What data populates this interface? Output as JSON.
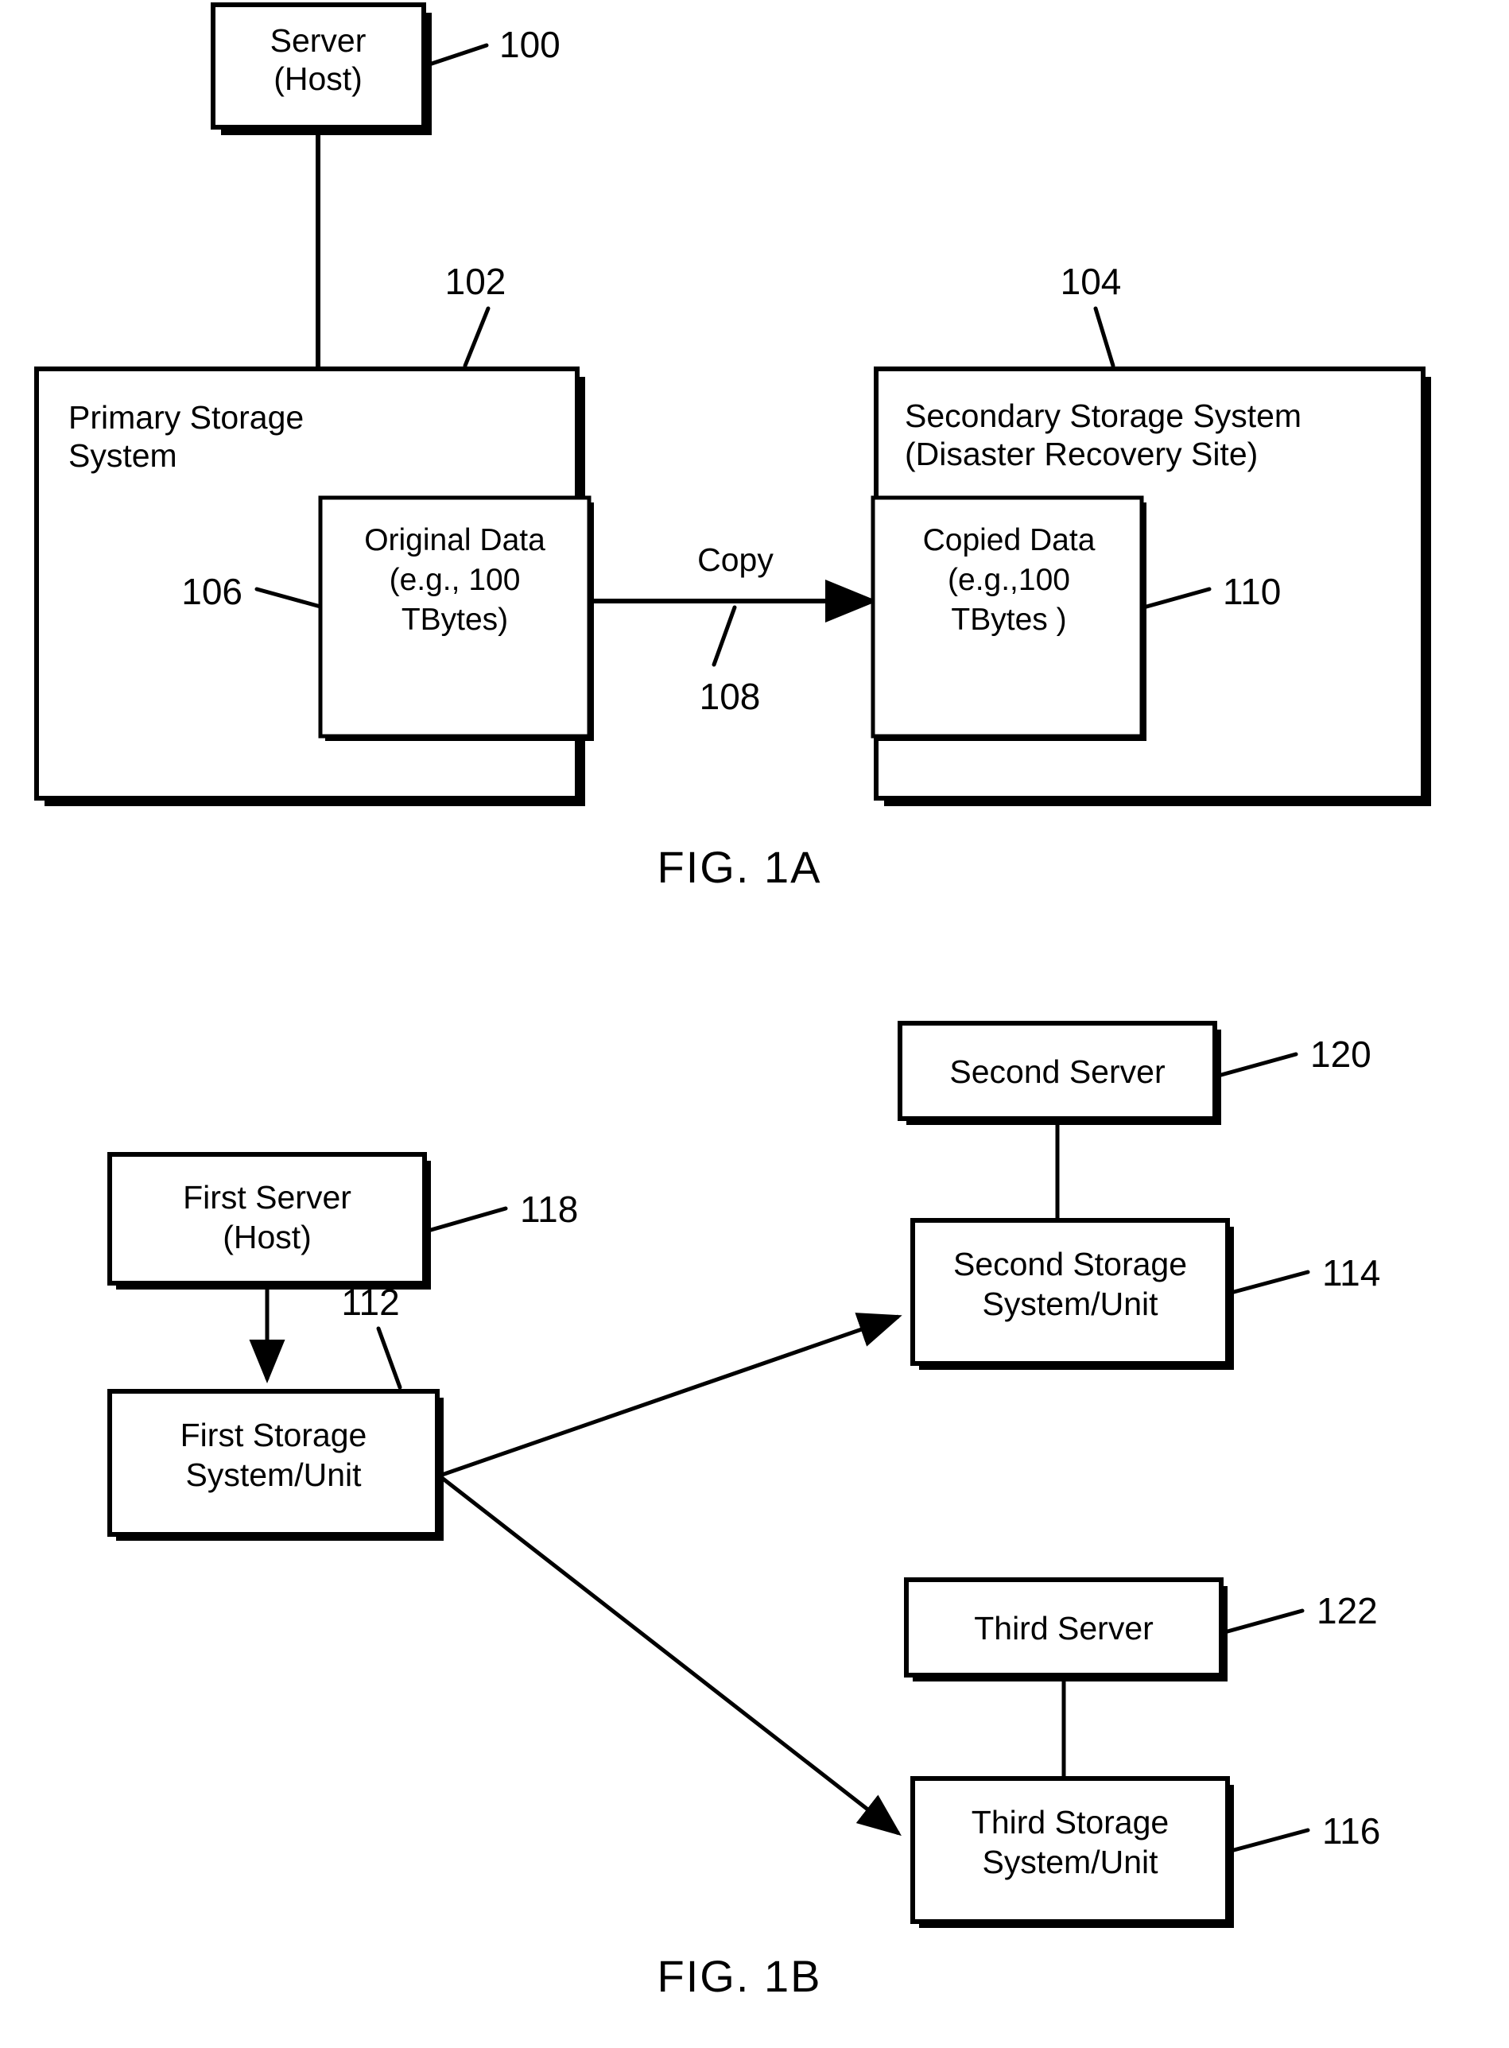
{
  "sheet": {
    "figures": [
      {
        "id": "fig-1a",
        "caption": "FIG. 1A",
        "nodes": [
          {
            "id": "server-host",
            "lines": [
              "Server",
              "(Host)"
            ],
            "ref": "100"
          },
          {
            "id": "primary-storage-system",
            "lines": [
              "Primary Storage",
              "System"
            ],
            "ref": "102"
          },
          {
            "id": "original-data",
            "lines": [
              "Original Data",
              "(e.g., 100",
              "TBytes)"
            ],
            "ref": "106"
          },
          {
            "id": "secondary-storage-system",
            "lines": [
              "Secondary Storage System",
              "(Disaster Recovery Site)"
            ],
            "ref": "104"
          },
          {
            "id": "copied-data",
            "lines": [
              "Copied Data",
              "(e.g.,100",
              "TBytes )"
            ],
            "ref": "110"
          }
        ],
        "edges": [
          {
            "id": "copy-arrow",
            "label": "Copy",
            "ref": "108",
            "from": "original-data",
            "to": "copied-data"
          },
          {
            "id": "host-to-primary",
            "label": "",
            "ref": "",
            "from": "server-host",
            "to": "primary-storage-system"
          }
        ]
      },
      {
        "id": "fig-1b",
        "caption": "FIG. 1B",
        "nodes": [
          {
            "id": "first-server",
            "lines": [
              "First Server",
              "(Host)"
            ],
            "ref": "118"
          },
          {
            "id": "first-storage",
            "lines": [
              "First Storage",
              "System/Unit"
            ],
            "ref": "112"
          },
          {
            "id": "second-server",
            "lines": [
              "Second Server"
            ],
            "ref": "120"
          },
          {
            "id": "second-storage",
            "lines": [
              "Second Storage",
              "System/Unit"
            ],
            "ref": "114"
          },
          {
            "id": "third-server",
            "lines": [
              "Third Server"
            ],
            "ref": "122"
          },
          {
            "id": "third-storage",
            "lines": [
              "Third Storage",
              "System/Unit"
            ],
            "ref": "116"
          }
        ],
        "edges": [
          {
            "id": "first-server-to-first-storage",
            "label": "",
            "ref": "",
            "from": "first-server",
            "to": "first-storage"
          },
          {
            "id": "first-to-second-storage",
            "label": "",
            "ref": "",
            "from": "first-storage",
            "to": "second-storage"
          },
          {
            "id": "first-to-third-storage",
            "label": "",
            "ref": "",
            "from": "first-storage",
            "to": "third-storage"
          },
          {
            "id": "second-server-to-second-storage",
            "label": "",
            "ref": "",
            "from": "second-server",
            "to": "second-storage"
          },
          {
            "id": "third-server-to-third-storage",
            "label": "",
            "ref": "",
            "from": "third-server",
            "to": "third-storage"
          }
        ]
      }
    ]
  },
  "fig1a": {
    "caption": "FIG. 1A",
    "server_host": {
      "line1": "Server",
      "line2": "(Host)",
      "ref": "100"
    },
    "primary": {
      "line1": "Primary Storage",
      "line2": "System",
      "ref": "102"
    },
    "original_data": {
      "line1": "Original Data",
      "line2": "(e.g., 100",
      "line3": "TBytes)",
      "ref": "106"
    },
    "secondary": {
      "line1": "Secondary Storage System",
      "line2": "(Disaster Recovery Site)",
      "ref": "104"
    },
    "copied_data": {
      "line1": "Copied Data",
      "line2": "(e.g.,100",
      "line3": "TBytes )",
      "ref": "110"
    },
    "copy_edge": {
      "label": "Copy",
      "ref": "108"
    }
  },
  "fig1b": {
    "caption": "FIG. 1B",
    "first_server": {
      "line1": "First Server",
      "line2": "(Host)",
      "ref": "118"
    },
    "first_storage": {
      "line1": "First Storage",
      "line2": "System/Unit",
      "ref": "112"
    },
    "second_server": {
      "line1": "Second Server",
      "ref": "120"
    },
    "second_storage": {
      "line1": "Second Storage",
      "line2": "System/Unit",
      "ref": "114"
    },
    "third_server": {
      "line1": "Third Server",
      "ref": "122"
    },
    "third_storage": {
      "line1": "Third Storage",
      "line2": "System/Unit",
      "ref": "116"
    }
  },
  "colors": {
    "ink": "#000000",
    "paper": "#ffffff"
  }
}
